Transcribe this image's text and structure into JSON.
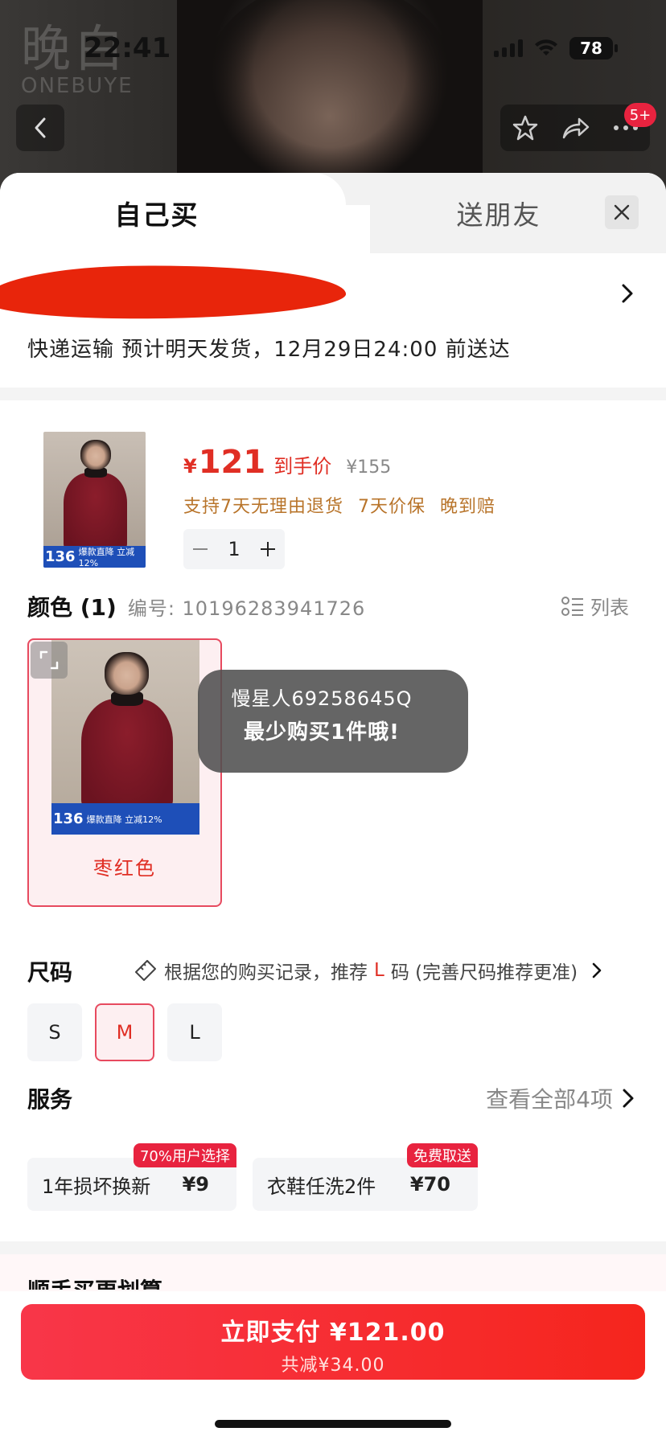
{
  "status_bar": {
    "time": "22:41",
    "battery": "78"
  },
  "brand": {
    "logo_cn": "晚白",
    "logo_en": "ONEBUYE"
  },
  "header": {
    "more_badge": "5+"
  },
  "tabs": {
    "self_buy": "自己买",
    "gift": "送朋友"
  },
  "shipping": {
    "delivery_text": "快递运输 预计明天发货，12月29日24:00 前送达"
  },
  "product": {
    "price_symbol": "¥",
    "price": "121",
    "price_tag": "到手价",
    "original_price": "¥155",
    "guarantees": [
      "支持7天无理由退货",
      "7天价保",
      "晚到赔"
    ],
    "quantity": "1",
    "thumb_promo_price": "136",
    "thumb_promo_text": "爆款直降 立减12%"
  },
  "color": {
    "heading": "颜色 (1)",
    "code_label": "编号: 10196283941726",
    "list_label": "列表",
    "options": [
      {
        "label": "枣红色",
        "promo_price": "136",
        "promo_text": "爆款直降 立减12%"
      }
    ]
  },
  "toast": {
    "line1": "慢星人69258645Q",
    "line2": "最少购买1件哦!"
  },
  "size": {
    "heading": "尺码",
    "tip_prefix": "根据您的购买记录，推荐",
    "tip_size": "L",
    "tip_suffix": "码 (完善尺码推荐更准)",
    "options": [
      "S",
      "M",
      "L"
    ],
    "selected": "M"
  },
  "service": {
    "heading": "服务",
    "view_all": "查看全部4项",
    "items": [
      {
        "name": "1年损坏换新",
        "price": "¥9",
        "badge": "70%用户选择"
      },
      {
        "name": "衣鞋任洗2件",
        "price": "¥70",
        "badge": "免费取送"
      }
    ]
  },
  "more_section": {
    "title": "顺手买更划算"
  },
  "pay": {
    "label": "立即支付 ¥121.00",
    "discount": "共减¥34.00"
  },
  "colors": {
    "accent": "#e02e24",
    "pay_start": "#f83649",
    "pay_end": "#f5251d",
    "guarantee": "#b8742a"
  }
}
